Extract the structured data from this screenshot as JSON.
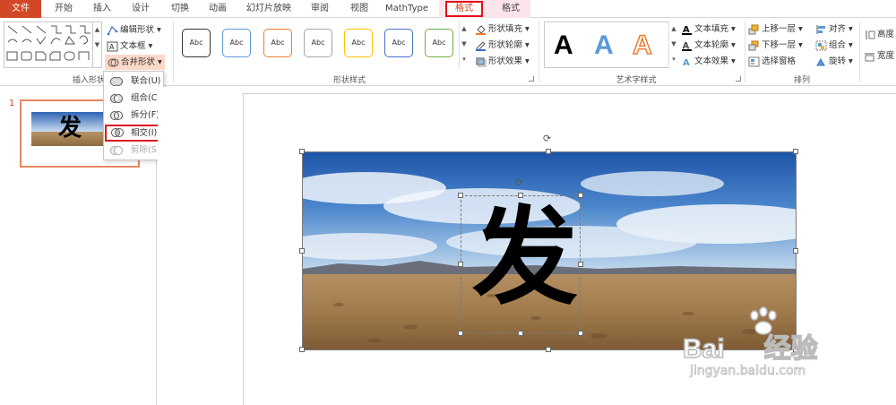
{
  "tabs": {
    "file": "文件",
    "home": "开始",
    "insert": "插入",
    "design": "设计",
    "transitions": "切换",
    "animations": "动画",
    "slideshow": "幻灯片放映",
    "review": "审阅",
    "view": "视图",
    "mathtype": "MathType",
    "format1": "格式",
    "format2": "格式"
  },
  "insert_shapes": {
    "edit_shape": "编辑形状",
    "text_box": "文本框",
    "merge_shapes": "合并形状",
    "group_label": "插入形状"
  },
  "merge_menu": {
    "items": [
      "联合(U)",
      "组合(C)",
      "拆分(F)",
      "相交(I)",
      "剪除(S)"
    ]
  },
  "shape_styles": {
    "samples": [
      "Abc",
      "Abc",
      "Abc",
      "Abc",
      "Abc",
      "Abc",
      "Abc"
    ],
    "sample_colors": [
      "#333333",
      "#5b9bd5",
      "#ed7d31",
      "#a5a5a5",
      "#ffc000",
      "#4472c4",
      "#70ad47"
    ],
    "fill": "形状填充",
    "outline": "形状轮廓",
    "effects": "形状效果",
    "group_label": "形状样式"
  },
  "wordart": {
    "samples": [
      "A",
      "A",
      "A"
    ],
    "text_fill": "文本填充",
    "text_outline": "文本轮廓",
    "text_effects": "文本效果",
    "group_label": "艺术字样式"
  },
  "arrange": {
    "bring_forward": "上移一层",
    "send_backward": "下移一层",
    "selection_pane": "选择窗格",
    "align": "对齐",
    "group": "组合",
    "rotate": "旋转",
    "group_label": "排列"
  },
  "size": {
    "height": "高度",
    "width": "宽度"
  },
  "slides": {
    "number": "1",
    "thumb_text": "发"
  },
  "canvas": {
    "text": "发"
  },
  "watermark": {
    "brand_a": "Bai",
    "brand_b": "经验",
    "url": "jingyan.baidu.com"
  }
}
